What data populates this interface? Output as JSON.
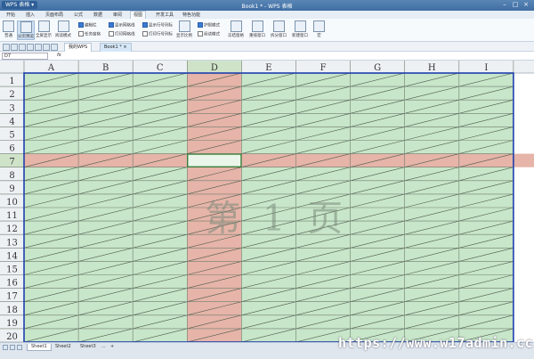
{
  "titlebar": {
    "app": "WPS 表格 ▾",
    "title": "Book1 * - WPS 表格",
    "min": "–",
    "max": "□",
    "close": "×"
  },
  "tabs": [
    {
      "label": "开始"
    },
    {
      "label": "插入"
    },
    {
      "label": "页面布局"
    },
    {
      "label": "公式"
    },
    {
      "label": "数据"
    },
    {
      "label": "审阅"
    },
    {
      "label": "视图"
    },
    {
      "label": "开发工具"
    },
    {
      "label": "特色功能"
    }
  ],
  "active_tab": "视图",
  "ribbon": {
    "buttons": [
      {
        "label": "普通",
        "icon": "normal-view-icon"
      },
      {
        "label": "分页预览",
        "icon": "page-break-preview-icon"
      },
      {
        "label": "全屏显示",
        "icon": "fullscreen-icon"
      },
      {
        "label": "阅读模式",
        "icon": "reading-mode-icon"
      },
      {
        "label": "显示比例",
        "icon": "zoom-icon"
      },
      {
        "label": "护眼模式",
        "icon": "eye-care-icon"
      },
      {
        "label": "冻结窗格",
        "icon": "freeze-panes-icon"
      },
      {
        "label": "重排窗口",
        "icon": "arrange-window-icon"
      },
      {
        "label": "拆分窗口",
        "icon": "split-window-icon"
      },
      {
        "label": "新建窗口",
        "icon": "new-window-icon"
      },
      {
        "label": "宏",
        "icon": "macro-icon"
      }
    ],
    "checks": [
      {
        "label": "编辑栏",
        "on": true
      },
      {
        "label": "任务窗格",
        "on": false
      },
      {
        "label": "显示网格线",
        "on": true
      },
      {
        "label": "打印网格线",
        "on": false
      },
      {
        "label": "显示行号列标",
        "on": true
      },
      {
        "label": "打印行号列标",
        "on": false
      },
      {
        "label": "护眼模式",
        "on": true
      },
      {
        "label": "阅读模式",
        "on": false
      }
    ]
  },
  "quickbar": {
    "doc_tab_1": "我的WPS",
    "doc_tab_2": "Book1 *",
    "close": "×"
  },
  "formula": {
    "name_box": "D7",
    "fx": "fx"
  },
  "grid": {
    "columns": [
      "A",
      "B",
      "C",
      "D",
      "E",
      "F",
      "G",
      "H",
      "I"
    ],
    "rows": [
      "1",
      "2",
      "3",
      "4",
      "5",
      "6",
      "7",
      "8",
      "9",
      "10",
      "11",
      "12",
      "13",
      "14",
      "15",
      "16",
      "17",
      "18",
      "19",
      "20"
    ],
    "selected_col": "D",
    "selected_row": "7",
    "page_label": "第 1 页",
    "colors": {
      "cell": "#c8e6c9",
      "highlight": "#e6b4a8",
      "gridline": "#4b5a4b",
      "border_blue": "#1d3fae"
    }
  },
  "sheets": [
    {
      "label": "Sheet1"
    },
    {
      "label": "Sheet2"
    },
    {
      "label": "Sheet3"
    }
  ],
  "sheet_controls": {
    "more": "...",
    "add": "+"
  },
  "watermark": "https://www.w17admin.cc"
}
